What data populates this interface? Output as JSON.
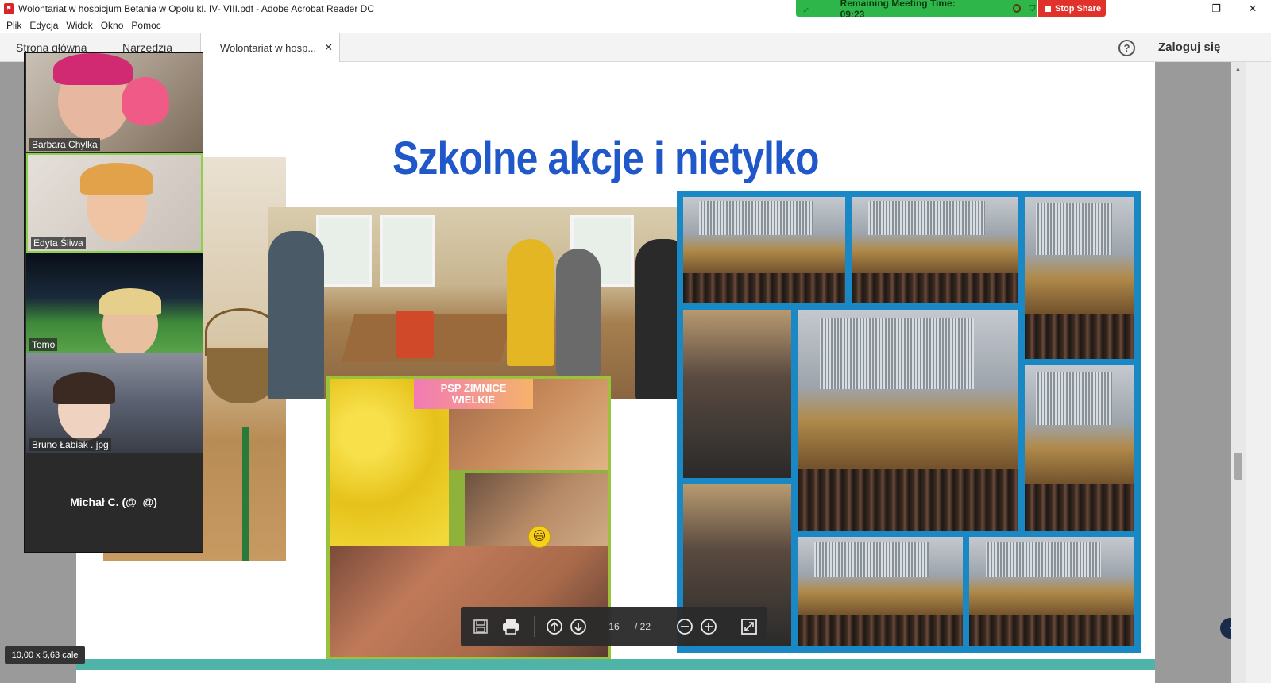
{
  "window": {
    "title": "Wolontariat w hospicjum Betania w Opolu kl. IV- VIII.pdf - Adobe Acrobat Reader DC",
    "controls": {
      "minimize": "–",
      "restore": "❐",
      "close": "✕"
    }
  },
  "meeting": {
    "remaining_label": "Remaining Meeting Time: 09:23",
    "stop_share_label": "Stop Share",
    "bar_color": "#2fb64a",
    "stop_color": "#e0322b"
  },
  "menu": {
    "items": [
      "Plik",
      "Edycja",
      "Widok",
      "Okno",
      "Pomoc"
    ]
  },
  "tabs": {
    "home": "Strona główna",
    "tools": "Narzędzia",
    "document": "Wolontariat w hosp...",
    "close": "✕",
    "help": "?",
    "login": "Zaloguj się"
  },
  "slide": {
    "title": "Szkolne akcje i nietylko",
    "title_color": "#2158c9",
    "psp_label_line1": "PSP ZIMNICE",
    "psp_label_line2": "WIELKIE",
    "smiley": "😃"
  },
  "viewer": {
    "page_current": "16",
    "page_total": "/ 22",
    "page_size": "10,00 x 5,63 cale",
    "icons": [
      "save-icon",
      "print-icon",
      "page-up-icon",
      "page-down-icon",
      "zoom-out-icon",
      "zoom-in-icon",
      "fit-page-icon"
    ]
  },
  "gallery": {
    "participants": [
      "Barbara Chyłka",
      "Edyta Śliwa",
      "Tomo",
      "Bruno Łabiak . jpg"
    ],
    "no_video_name": "Michał C. (@_@)"
  }
}
